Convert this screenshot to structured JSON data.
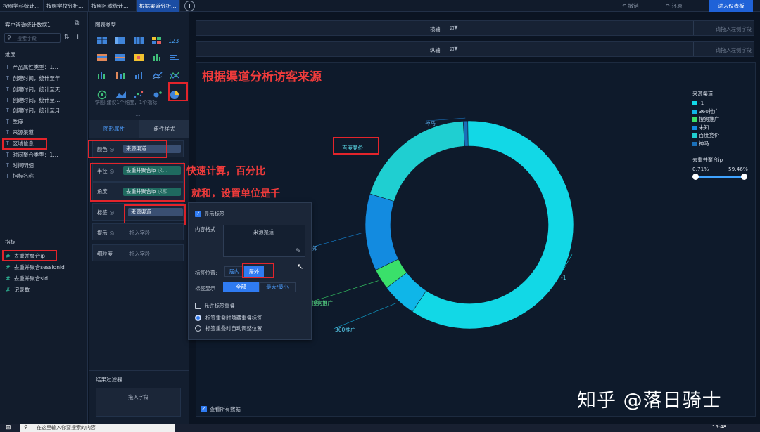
{
  "tabs": [
    {
      "label": "按照学科统计…",
      "active": false
    },
    {
      "label": "按照学校分析…",
      "active": false
    },
    {
      "label": "按照区域统计…",
      "active": false
    },
    {
      "label": "根据渠道分析…",
      "active": true
    }
  ],
  "toolbar": {
    "undo": "撤销",
    "redo": "还原",
    "enter_dashboard": "进入仪表板"
  },
  "left_panel": {
    "dataset_title": "客户咨询统计数据1",
    "search_placeholder": "搜索字段",
    "dimension_heading": "维度",
    "dimensions": [
      "产品属性类型：1…",
      "创建时间，统计至年",
      "创建时间，统计至天",
      "创建时间，统计至…",
      "创建时间，统计至月",
      "季度",
      "来源渠道",
      "区域信息",
      "时间聚合类型：1…",
      "时间明细",
      "指标名称"
    ],
    "measure_heading": "指标",
    "measures": [
      "去重并聚合ip",
      "去重并聚合sessionid",
      "去重并聚合sid",
      "记录数"
    ]
  },
  "chart_type_panel": {
    "title": "图表类型",
    "hint": "饼图:建议1个维度，1个指标",
    "tab_properties": "图形属性",
    "tab_style": "组件样式",
    "rows": [
      {
        "label": "颜色",
        "value": "来源渠道"
      },
      {
        "label": "半径",
        "value": "去重并聚合ip",
        "suffix": "求…"
      },
      {
        "label": "角度",
        "value": "去重并聚合ip",
        "suffix": "求和"
      },
      {
        "label": "标签",
        "value": "来源渠道"
      },
      {
        "label": "提示",
        "value": "拖入字段"
      },
      {
        "label": "细粒度",
        "value": "拖入字段"
      }
    ],
    "filter_title": "结果过滤器",
    "filter_placeholder": "拖入字段"
  },
  "axis_bars": {
    "x_label": "横轴",
    "y_label": "纵轴",
    "x_placeholder": "请拖入左侧字段",
    "y_placeholder": "请拖入左侧字段"
  },
  "chart_title": "根据渠道分析访客来源",
  "annotations": [
    "快速计算，百分比",
    "就和，设置单位是千"
  ],
  "label_popup": {
    "show_label": "显示标签",
    "content_format_label": "内容格式",
    "content_value": "来源渠道",
    "position_label": "标签位置:",
    "position_inside": "居内",
    "position_outside": "居外",
    "display_label": "标签显示",
    "display_all": "全部",
    "display_minmax": "最大/最小",
    "allow_overlap": "允许标签重叠",
    "radio_hide": "标签重叠时隐藏重叠标签",
    "radio_adjust": "标签重叠时自动调整位置"
  },
  "show_all_data": "查看所有数据",
  "legend": {
    "title": "来源渠道",
    "size_title": "去重并聚合ip",
    "range_min": "0.71%",
    "range_max": "59.46%"
  },
  "taskbar": {
    "search_placeholder": "在这里输入你要搜索的内容",
    "time": "15:48"
  },
  "watermark": "知乎 @落日骑士",
  "chart_data": {
    "type": "pie",
    "donut": true,
    "series": [
      {
        "name": "-1",
        "value": 59.46,
        "color": "#12d8e6"
      },
      {
        "name": "360推广",
        "value": 5.4,
        "color": "#0fb6e8"
      },
      {
        "name": "搜狗推广",
        "value": 3.2,
        "color": "#3ae06a"
      },
      {
        "name": "未知",
        "value": 12.0,
        "color": "#138be0"
      },
      {
        "name": "百度竞价",
        "value": 19.23,
        "color": "#1fcfd1"
      },
      {
        "name": "神马",
        "value": 0.71,
        "color": "#1a6fb8"
      }
    ],
    "visible_labels": [
      "神马",
      "百度竞价",
      "知",
      "搜狗推广",
      "360推广",
      "-1"
    ]
  }
}
